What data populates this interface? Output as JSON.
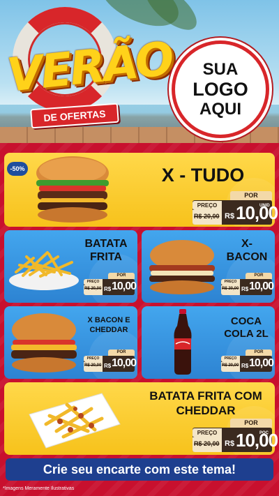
{
  "header": {
    "title": "VERÃO",
    "subtitle": "DE OFERTAS",
    "logo_lines": [
      "SUA",
      "LOGO",
      "AQUI"
    ]
  },
  "colors": {
    "brand_red": "#c8102e",
    "card_yellow": "#f7c21b",
    "card_blue": "#2d83d2",
    "title_yellow": "#ffd21a",
    "cta_blue": "#1e3f8f",
    "price_dark": "#3b2a1f"
  },
  "products": [
    {
      "name": "X - TUDO",
      "badge": "-50%",
      "por": "POR",
      "preco": "PREÇO",
      "old": "R$ 20,00",
      "rs": "R$",
      "value": "10,00",
      "unit": "UNID",
      "icon": "burger-icon"
    },
    {
      "name_lines": [
        "BATATA",
        "FRITA"
      ],
      "por": "POR",
      "preco": "PREÇO",
      "old": "R$ 20,00",
      "rs": "R$",
      "value": "10,00",
      "icon": "fries-icon"
    },
    {
      "name_lines": [
        "X-",
        "BACON"
      ],
      "por": "POR",
      "preco": "PREÇO",
      "old": "R$ 20,00",
      "rs": "R$",
      "value": "10,00",
      "icon": "bacon-burger-icon"
    },
    {
      "name_lines": [
        "X BACON E",
        "CHEDDAR"
      ],
      "por": "POR",
      "preco": "PREÇO",
      "old": "R$ 20,00",
      "rs": "R$",
      "value": "10,00",
      "icon": "cheddar-burger-icon"
    },
    {
      "name_lines": [
        "COCA",
        "COLA 2L"
      ],
      "por": "POR",
      "preco": "PREÇO",
      "old": "R$ 20,00",
      "rs": "R$",
      "value": "10,00",
      "icon": "soda-bottle-icon"
    },
    {
      "name_lines": [
        "BATATA FRITA COM",
        "CHEDDAR"
      ],
      "por": "POR",
      "preco": "PREÇO",
      "old": "R$ 20,00",
      "rs": "R$",
      "value": "10,00",
      "unit": "POÇ",
      "icon": "cheddar-fries-icon"
    }
  ],
  "cta": "Crie seu encarte com este tema!",
  "disclaimer": "*Imagens Meramente Ilustrativas"
}
